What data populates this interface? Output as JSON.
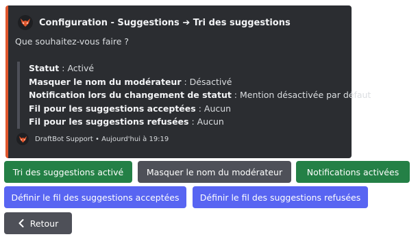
{
  "embed": {
    "author_title": "Configuration - Suggestions ➔ Tri des suggestions",
    "description": "Que souhaitez-vous faire ?",
    "fields": [
      {
        "label": "Statut",
        "value": "Activé"
      },
      {
        "label": "Masquer le nom du modérateur",
        "value": "Désactivé"
      },
      {
        "label": "Notification lors du changement de statut",
        "value": "Mention désactivée par défaut"
      },
      {
        "label": "Fil pour les suggestions acceptées",
        "value": "Aucun"
      },
      {
        "label": "Fil pour les suggestions refusées",
        "value": "Aucun"
      }
    ],
    "separator": " : ",
    "footer": "DraftBot Support • Aujourd'hui à 19:19",
    "accent_color": "#e0562c",
    "icon": "draftbot-fox-logo-icon"
  },
  "buttons": {
    "sort_enabled": "Tri des suggestions activé",
    "hide_moderator": "Masquer le nom du modérateur",
    "notifications_enabled": "Notifications activées",
    "set_accepted_thread": "Définir le fil des suggestions acceptées",
    "set_refused_thread": "Définir le fil des suggestions refusées",
    "back": "Retour",
    "back_icon": "chevron-left-icon"
  },
  "colors": {
    "success": "#248046",
    "secondary": "#4e5058",
    "primary": "#5865f2",
    "embed_bg": "#2b2d31"
  }
}
